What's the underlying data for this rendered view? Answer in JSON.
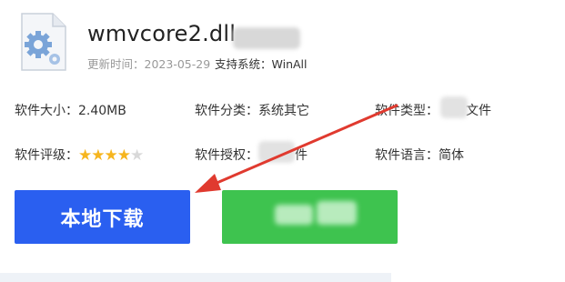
{
  "file": {
    "title": "wmvcore2.dll",
    "icon": "gear-file-icon",
    "update_label": "更新时间：",
    "update_value": "2023-05-29",
    "system_label": "支持系统：",
    "system_value": "WinAll"
  },
  "info": {
    "size_label": "软件大小：",
    "size_value": "2.40MB",
    "category_label": "软件分类：",
    "category_value": "系统其它",
    "type_label": "软件类型：",
    "type_suffix": "文件",
    "rating_label": "软件评级：",
    "rating_value": 4,
    "rating_max": 5,
    "license_label": "软件授权：",
    "license_suffix": "件",
    "language_label": "软件语言：",
    "language_value": "简体"
  },
  "buttons": {
    "local_download": "本地下载"
  },
  "colors": {
    "primary_blue": "#2a5ff0",
    "green": "#3ec34f",
    "star": "#f6b51e",
    "arrow_red": "#e03a2f"
  }
}
